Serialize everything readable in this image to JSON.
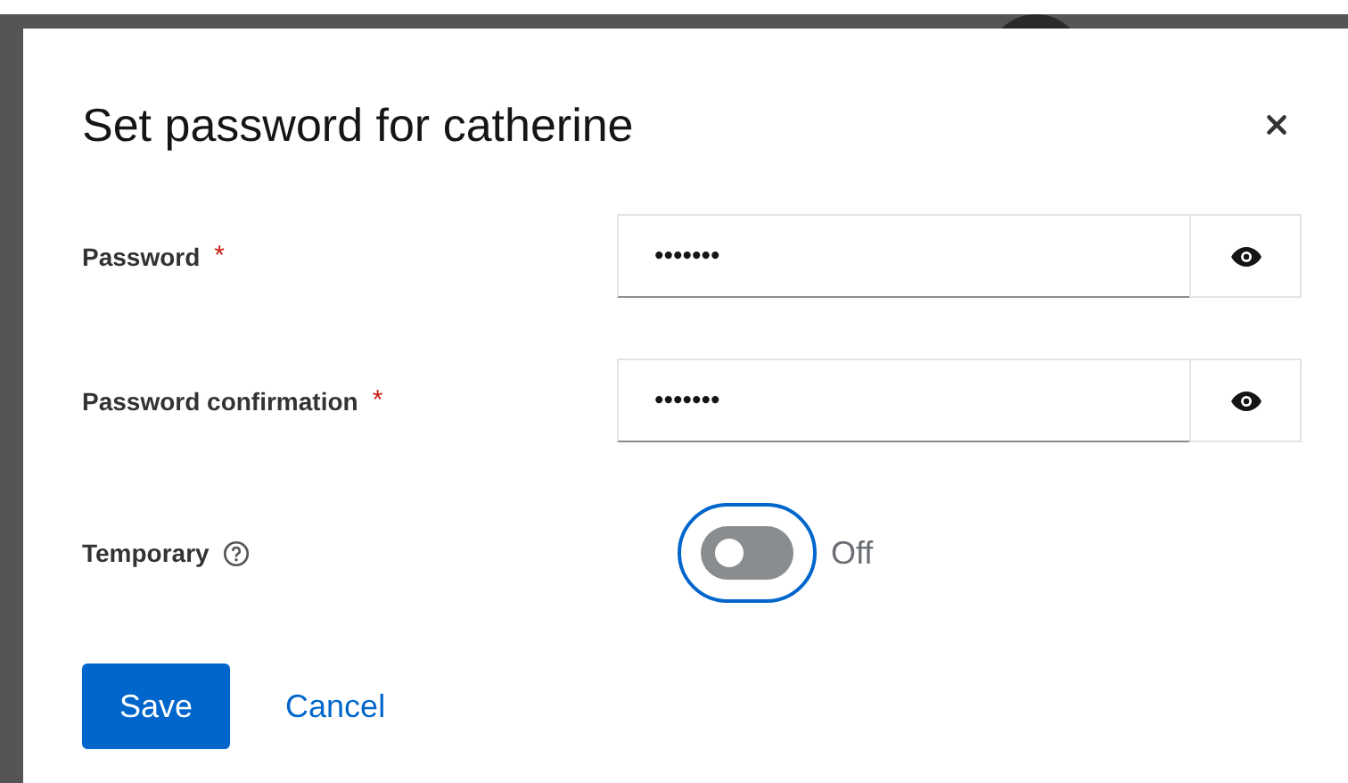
{
  "dialog": {
    "title": "Set password for catherine"
  },
  "required_mark": "*",
  "fields": [
    {
      "label": "Password",
      "required": true,
      "value": "•••••••"
    },
    {
      "label": "Password confirmation",
      "required": true,
      "value": "•••••••"
    }
  ],
  "temporary": {
    "label": "Temporary",
    "on": false,
    "focused": true,
    "state_text": "Off"
  },
  "buttons": [
    {
      "label": "Save",
      "kind": "primary"
    },
    {
      "label": "Cancel",
      "kind": "link"
    }
  ]
}
